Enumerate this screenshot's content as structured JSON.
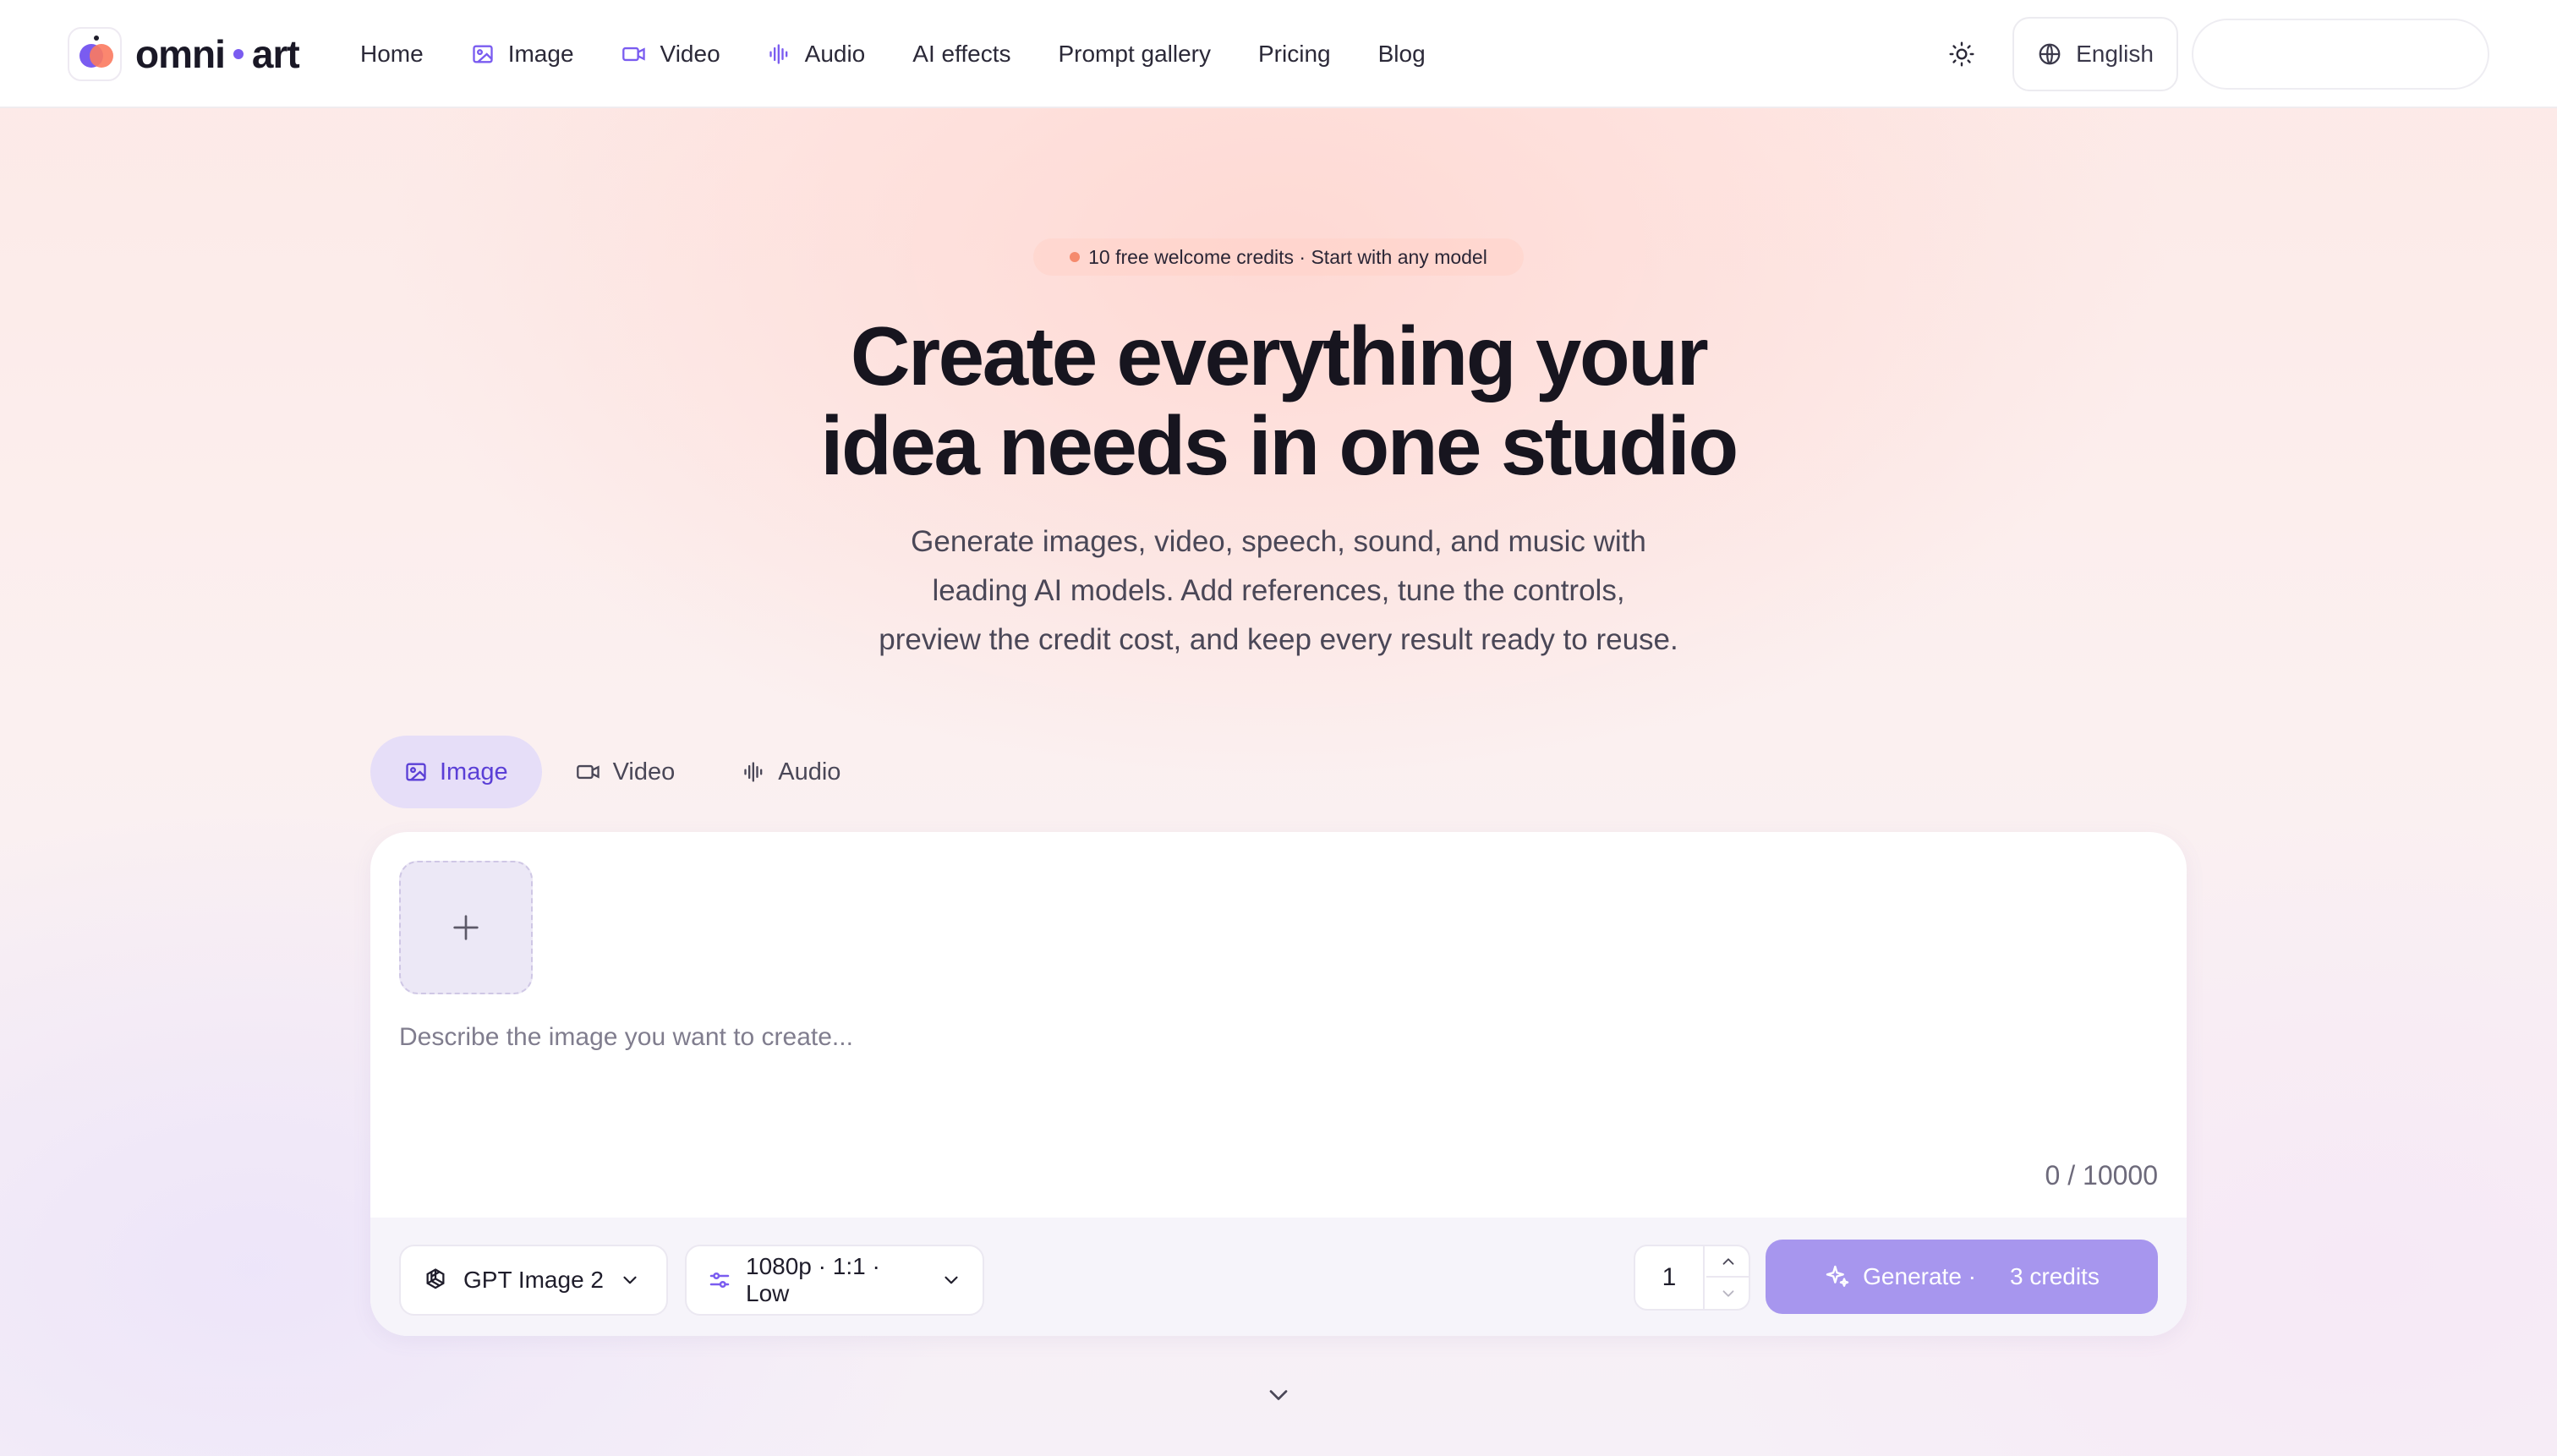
{
  "brand": {
    "name_left": "omni",
    "name_right": "art"
  },
  "nav": {
    "home": "Home",
    "image": "Image",
    "video": "Video",
    "audio": "Audio",
    "ai_effects": "AI effects",
    "prompt_gallery": "Prompt gallery",
    "pricing": "Pricing",
    "blog": "Blog"
  },
  "header": {
    "language": "English"
  },
  "hero": {
    "badge": "10 free welcome credits · Start with any model",
    "title_line1": "Create everything your",
    "title_line2": "idea needs in one studio",
    "sub_line1": "Generate images, video, speech, sound, and music with",
    "sub_line2": "leading AI models. Add references, tune the controls,",
    "sub_line3": "preview the credit cost, and keep every result ready to reuse."
  },
  "tabs": [
    {
      "label": "Image",
      "active": true
    },
    {
      "label": "Video",
      "active": false
    },
    {
      "label": "Audio",
      "active": false
    }
  ],
  "composer": {
    "prompt_placeholder": "Describe the image you want to create...",
    "char_count": "0 / 10000",
    "model": "GPT Image 2",
    "settings": "1080p · 1:1 · Low",
    "quantity": "1",
    "generate_label": "Generate ·",
    "generate_credits": "3 credits"
  },
  "colors": {
    "accent": "#7a5cf0",
    "accent_soft": "#e6def8",
    "generate_bg": "#a796ee",
    "badge_dot": "#f58a6d"
  },
  "icons": {
    "nav_image": "image-icon",
    "nav_video": "video-icon",
    "nav_audio": "audio-wave-icon",
    "theme": "sun-icon",
    "language": "globe-icon",
    "upload": "plus-icon",
    "model": "openai-icon",
    "settings": "sliders-icon",
    "generate": "sparkle-icon",
    "scroll": "chevron-down-icon"
  }
}
